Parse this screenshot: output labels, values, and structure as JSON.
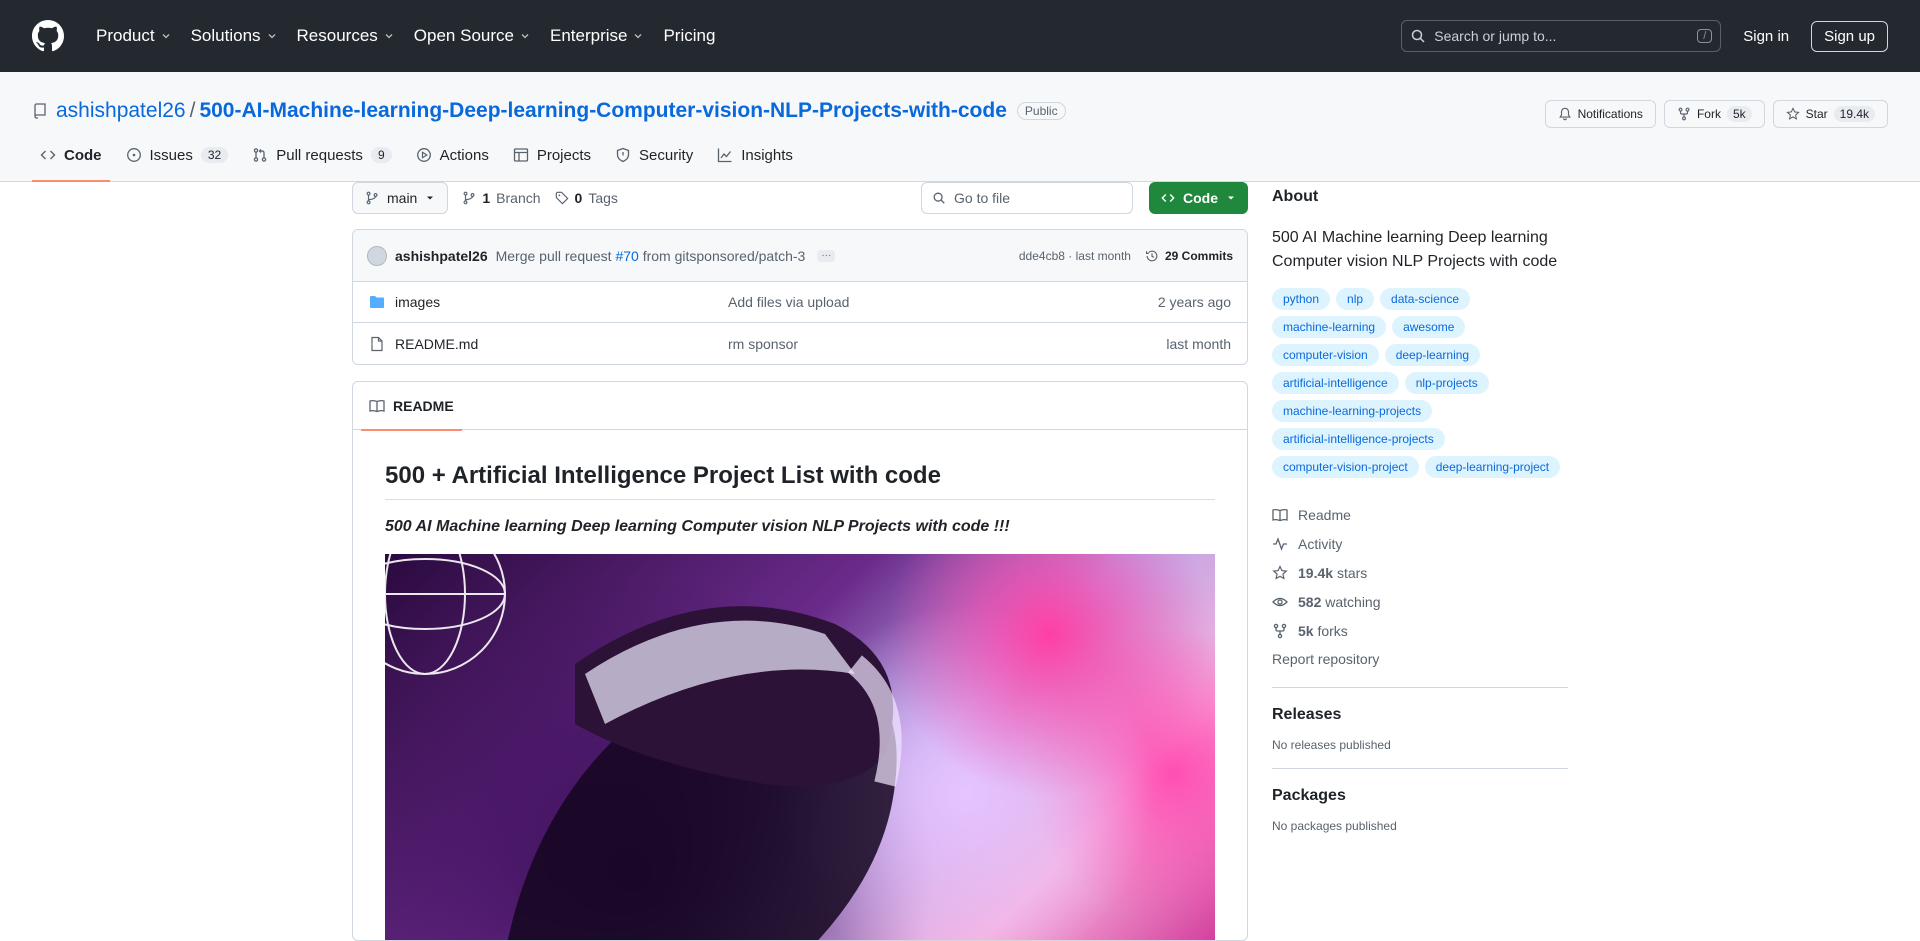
{
  "header": {
    "nav": [
      {
        "label": "Product",
        "dropdown": true
      },
      {
        "label": "Solutions",
        "dropdown": true
      },
      {
        "label": "Resources",
        "dropdown": true
      },
      {
        "label": "Open Source",
        "dropdown": true
      },
      {
        "label": "Enterprise",
        "dropdown": true
      },
      {
        "label": "Pricing",
        "dropdown": false
      }
    ],
    "search_placeholder": "Search or jump to...",
    "search_key": "/",
    "sign_in": "Sign in",
    "sign_up": "Sign up"
  },
  "repo": {
    "owner": "ashishpatel26",
    "separator": "/",
    "name": "500-AI-Machine-learning-Deep-learning-Computer-vision-NLP-Projects-with-code",
    "visibility": "Public",
    "notifications_label": "Notifications",
    "fork_label": "Fork",
    "fork_count": "5k",
    "star_label": "Star",
    "star_count": "19.4k"
  },
  "tabs": [
    {
      "label": "Code",
      "icon": "code-icon",
      "count": null,
      "active": true
    },
    {
      "label": "Issues",
      "icon": "issue-icon",
      "count": "32",
      "active": false
    },
    {
      "label": "Pull requests",
      "icon": "pull-request-icon",
      "count": "9",
      "active": false
    },
    {
      "label": "Actions",
      "icon": "play-icon",
      "count": null,
      "active": false
    },
    {
      "label": "Projects",
      "icon": "table-icon",
      "count": null,
      "active": false
    },
    {
      "label": "Security",
      "icon": "shield-icon",
      "count": null,
      "active": false
    },
    {
      "label": "Insights",
      "icon": "graph-icon",
      "count": null,
      "active": false
    }
  ],
  "file_nav": {
    "branch": "main",
    "branches_count": "1",
    "branches_label": "Branch",
    "tags_count": "0",
    "tags_label": "Tags",
    "goto_placeholder": "Go to file",
    "code_button": "Code"
  },
  "commit": {
    "author": "ashishpatel26",
    "message_prefix": "Merge pull request",
    "pr_link": "#70",
    "message_suffix": "from gitsponsored/patch-3",
    "sha": "dde4cb8",
    "separator": "·",
    "when": "last month",
    "commits_label": "29 Commits"
  },
  "files": [
    {
      "name": "images",
      "type": "folder",
      "commit": "Add files via upload",
      "date": "2 years ago"
    },
    {
      "name": "README.md",
      "type": "file",
      "commit": "rm sponsor",
      "date": "last month"
    }
  ],
  "readme": {
    "tab_label": "README",
    "title": "500 + Artificial Intelligence Project List with code",
    "subtitle": "500 AI Machine learning Deep learning Computer vision NLP Projects with code !!!"
  },
  "sidebar": {
    "about_heading": "About",
    "description": "500 AI Machine learning Deep learning Computer vision NLP Projects with code",
    "topics": [
      "python",
      "nlp",
      "data-science",
      "machine-learning",
      "awesome",
      "computer-vision",
      "deep-learning",
      "artificial-intelligence",
      "nlp-projects",
      "machine-learning-projects",
      "artificial-intelligence-projects",
      "computer-vision-project",
      "deep-learning-project"
    ],
    "links": [
      {
        "icon": "book-icon",
        "value": "",
        "label": "Readme"
      },
      {
        "icon": "pulse-icon",
        "value": "",
        "label": "Activity"
      },
      {
        "icon": "star-icon",
        "value": "19.4k",
        "label": "stars"
      },
      {
        "icon": "eye-icon",
        "value": "582",
        "label": "watching"
      },
      {
        "icon": "fork-icon",
        "value": "5k",
        "label": "forks"
      }
    ],
    "report": "Report repository",
    "releases_heading": "Releases",
    "releases_text": "No releases published",
    "packages_heading": "Packages",
    "packages_text": "No packages published"
  },
  "colors": {
    "header_bg": "#24292f",
    "link": "#0969da",
    "code_button": "#1f883d",
    "active_tab_underline": "#fd8c73",
    "topic_bg": "#ddf4ff"
  }
}
